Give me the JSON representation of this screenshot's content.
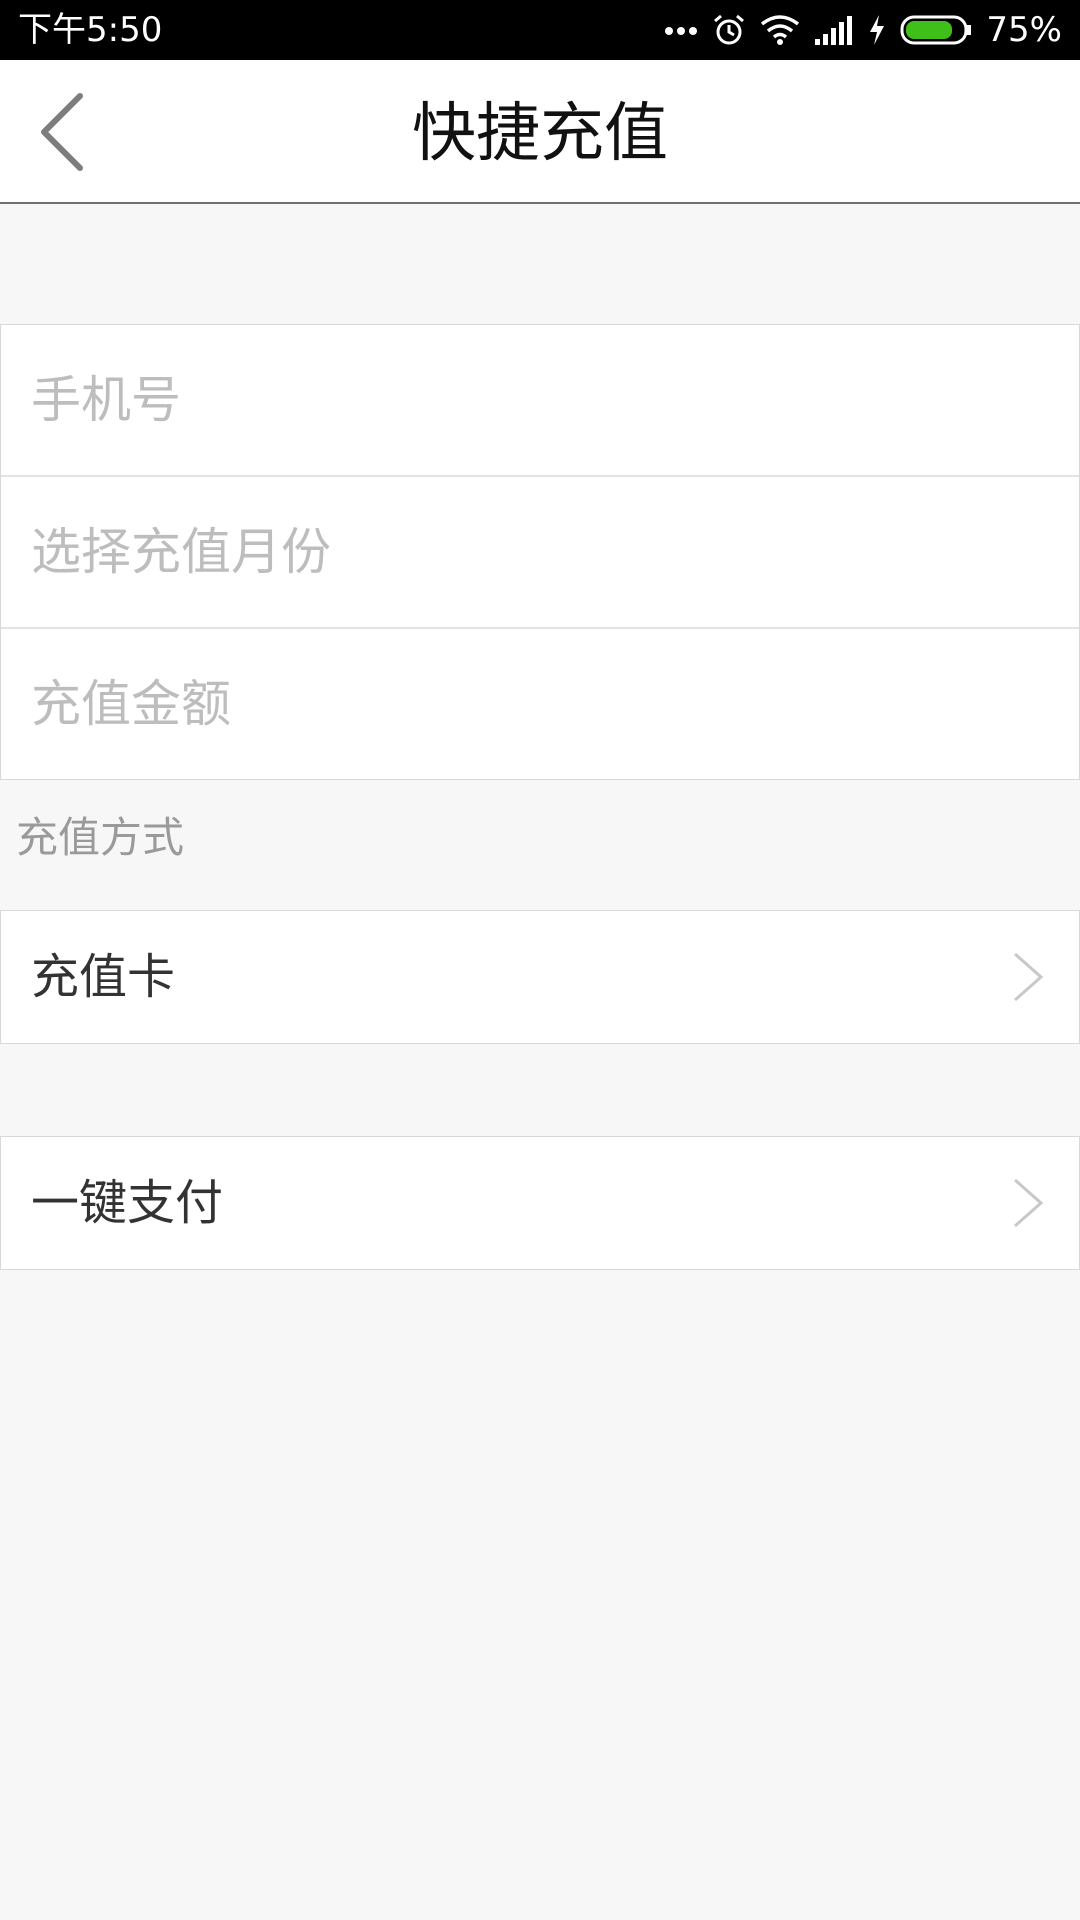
{
  "status_bar": {
    "time": "下午5:50",
    "battery_percent": "75%",
    "icons": [
      "more-dots-icon",
      "alarm-icon",
      "wifi-icon",
      "signal-icon",
      "charging-icon",
      "battery-icon"
    ],
    "battery_level": 0.75,
    "battery_color": "#3fbf1a"
  },
  "nav": {
    "back_icon": "back-arrow-icon",
    "title": "快捷充值"
  },
  "form": {
    "phone_placeholder": "手机号",
    "month_placeholder": "选择充值月份",
    "amount_placeholder": "充值金额"
  },
  "payment_section": {
    "label": "充值方式",
    "options": [
      {
        "label": "充值卡",
        "icon": "chevron-right-icon"
      },
      {
        "label": "一键支付",
        "icon": "chevron-right-icon"
      }
    ]
  }
}
